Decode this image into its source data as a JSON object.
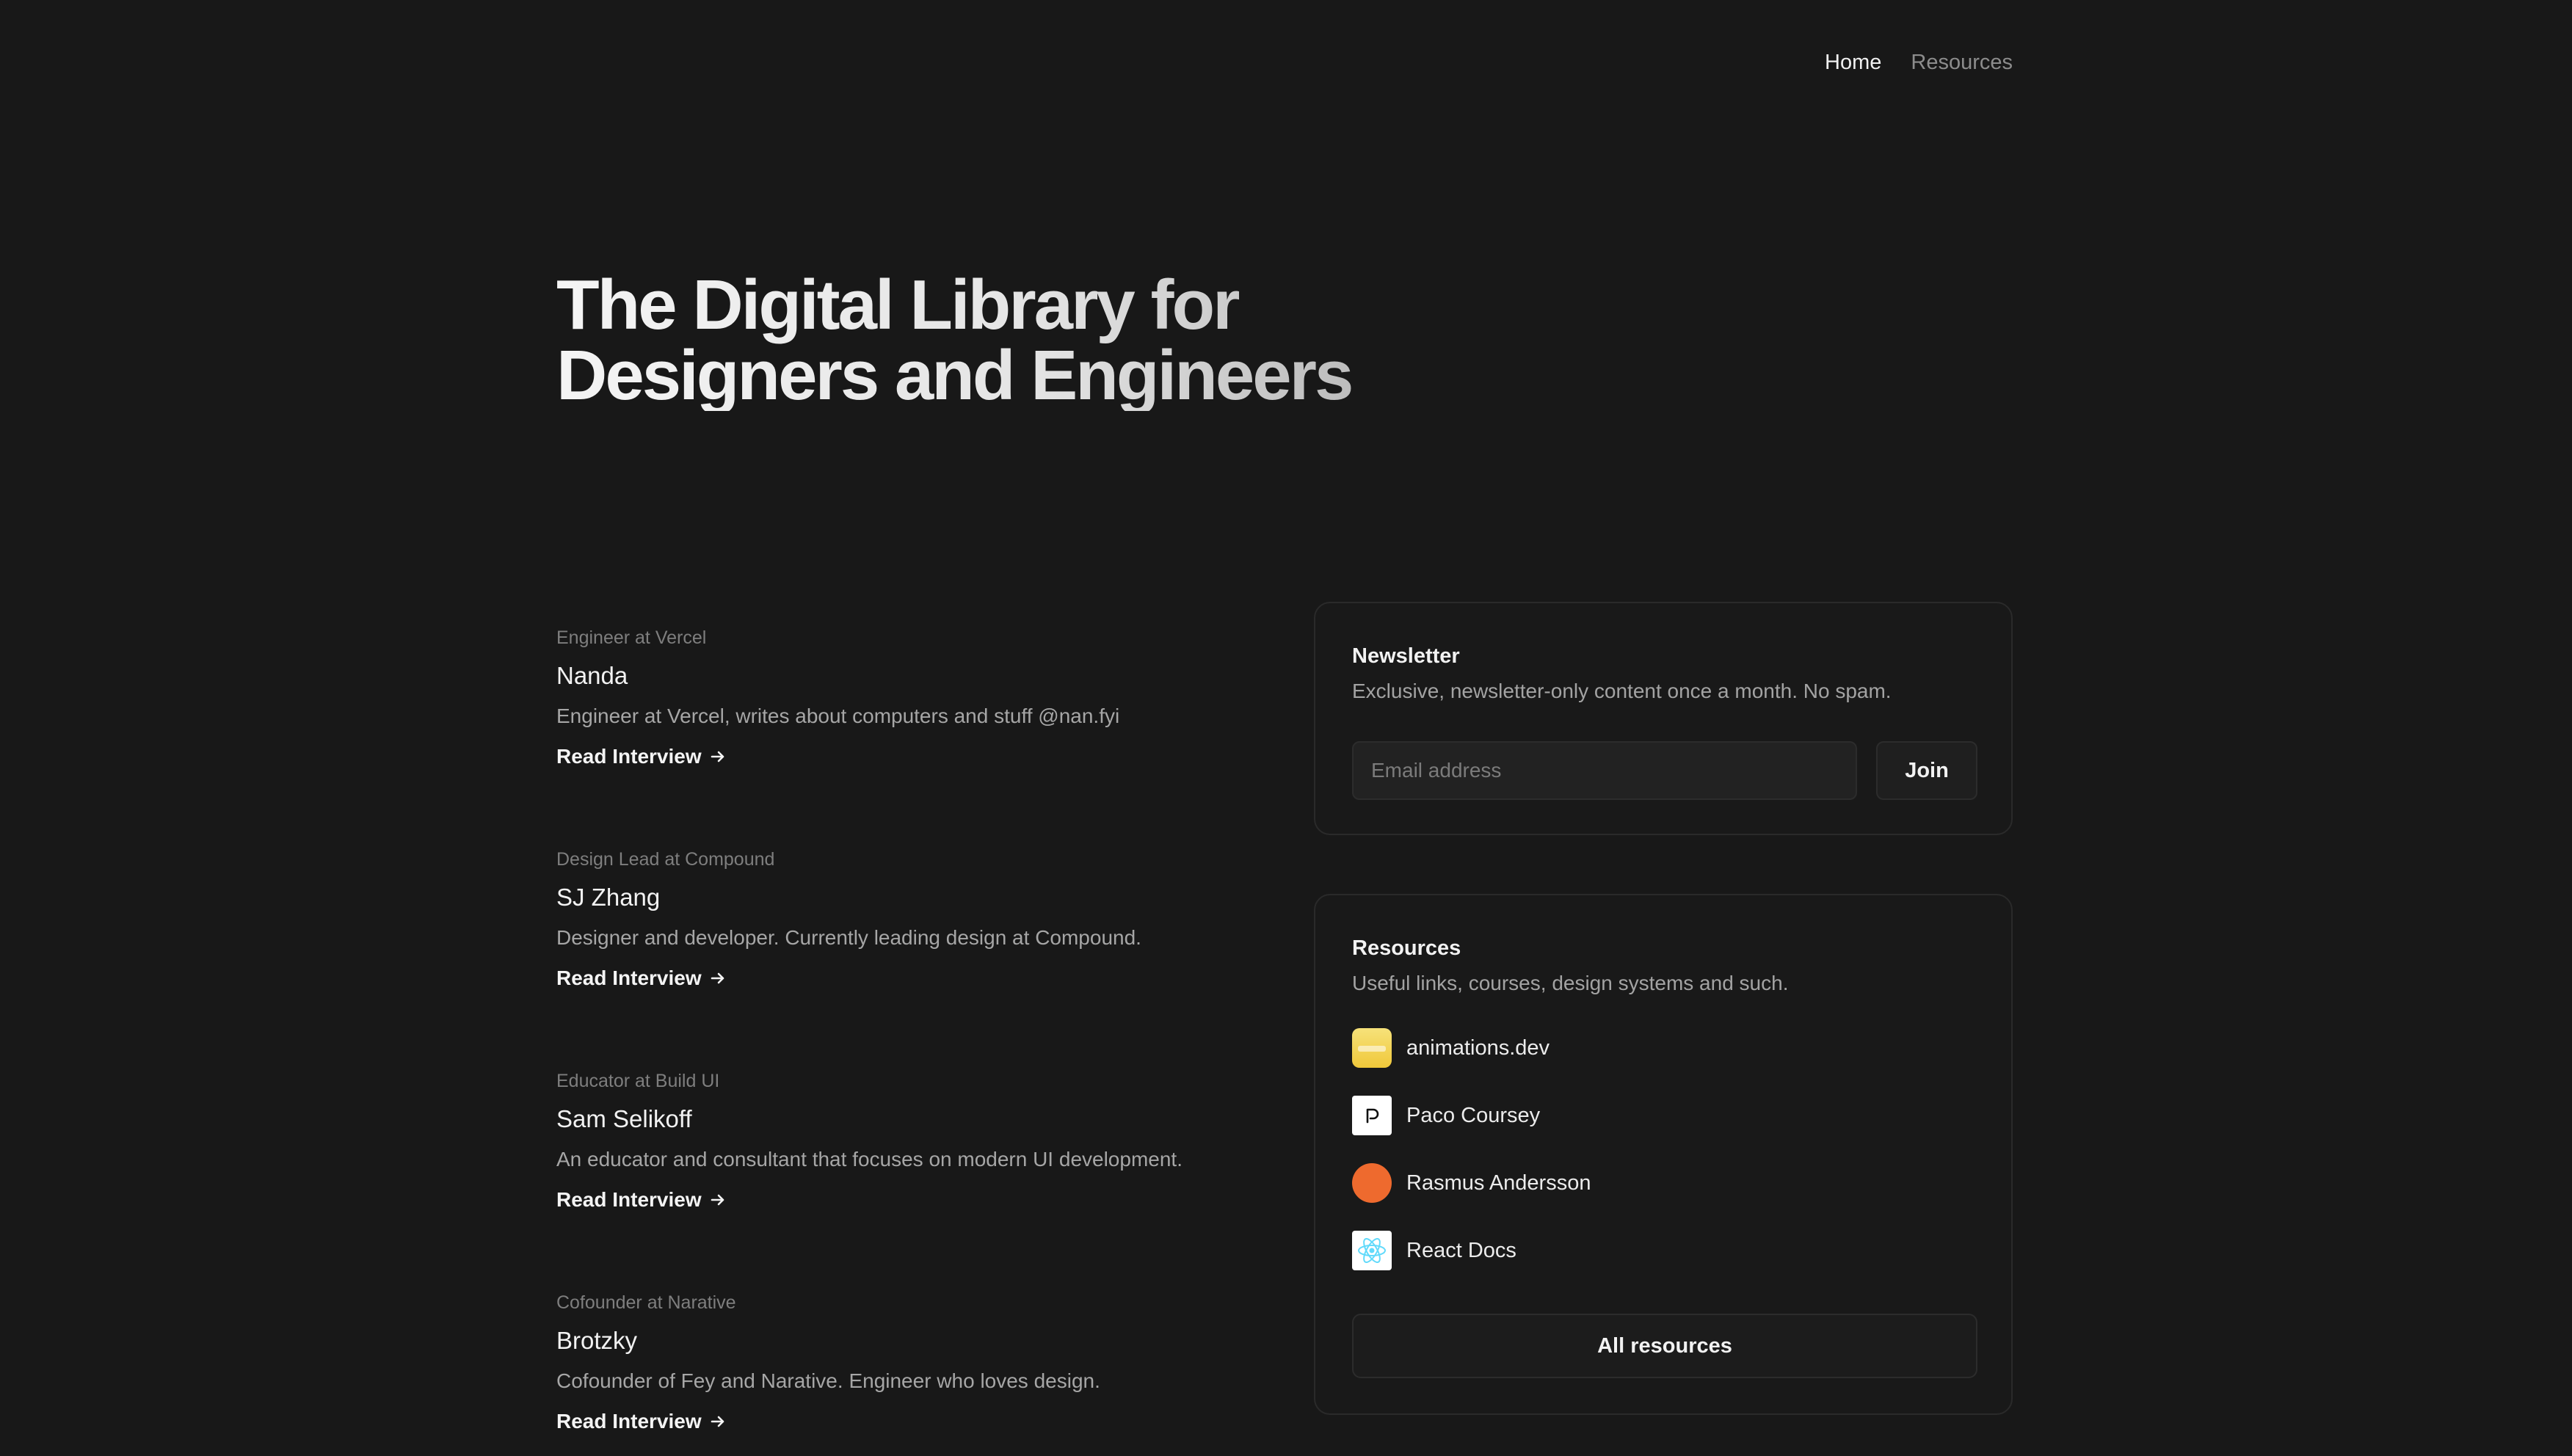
{
  "nav": {
    "home": "Home",
    "resources": "Resources"
  },
  "hero": {
    "line1": "The Digital Library for",
    "line2": "Designers and Engineers"
  },
  "interviews": [
    {
      "role": "Engineer at Vercel",
      "name": "Nanda",
      "description": "Engineer at Vercel, writes about computers and stuff @nan.fyi",
      "cta": "Read Interview"
    },
    {
      "role": "Design Lead at Compound",
      "name": "SJ Zhang",
      "description": "Designer and developer. Currently leading design at Compound.",
      "cta": "Read Interview"
    },
    {
      "role": "Educator at Build UI",
      "name": "Sam Selikoff",
      "description": "An educator and consultant that focuses on modern UI development.",
      "cta": "Read Interview"
    },
    {
      "role": "Cofounder at Narative",
      "name": "Brotzky",
      "description": "Cofounder of Fey and Narative. Engineer who loves design.",
      "cta": "Read Interview"
    }
  ],
  "newsletter": {
    "title": "Newsletter",
    "subtitle": "Exclusive, newsletter-only content once a month. No spam.",
    "email_placeholder": "Email address",
    "email_value": "",
    "join_label": "Join"
  },
  "resources": {
    "title": "Resources",
    "subtitle": "Useful links, courses, design systems and such.",
    "items": [
      {
        "label": "animations.dev",
        "icon": "animations-dev-icon"
      },
      {
        "label": "Paco Coursey",
        "icon": "paco-coursey-icon"
      },
      {
        "label": "Rasmus Andersson",
        "icon": "rasmus-andersson-icon"
      },
      {
        "label": "React Docs",
        "icon": "react-icon"
      }
    ],
    "all_label": "All resources"
  },
  "colors": {
    "background": "#181818",
    "card_border": "#2a2a2a",
    "rasmus_orange": "#ee6a2e",
    "react_blue": "#61dafb"
  }
}
